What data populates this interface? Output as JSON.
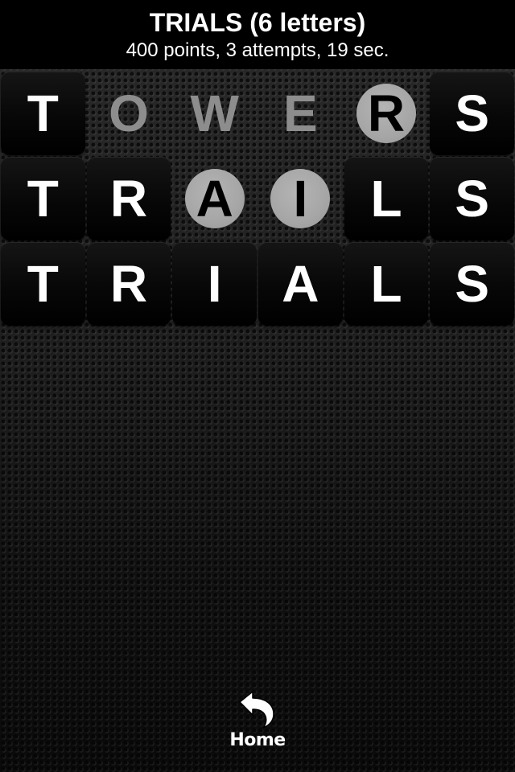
{
  "header": {
    "title": "TRIALS (6 letters)",
    "subtitle": "400 points, 3 attempts, 19 sec."
  },
  "board": {
    "rows": [
      {
        "word": "TOWERS",
        "tiles": [
          {
            "letter": "T",
            "state": "correct"
          },
          {
            "letter": "O",
            "state": "absent"
          },
          {
            "letter": "W",
            "state": "absent"
          },
          {
            "letter": "E",
            "state": "absent"
          },
          {
            "letter": "R",
            "state": "present"
          },
          {
            "letter": "S",
            "state": "correct"
          }
        ]
      },
      {
        "word": "TRAILS",
        "tiles": [
          {
            "letter": "T",
            "state": "correct"
          },
          {
            "letter": "R",
            "state": "correct"
          },
          {
            "letter": "A",
            "state": "present"
          },
          {
            "letter": "I",
            "state": "present"
          },
          {
            "letter": "L",
            "state": "correct"
          },
          {
            "letter": "S",
            "state": "correct"
          }
        ]
      },
      {
        "word": "TRIALS",
        "tiles": [
          {
            "letter": "T",
            "state": "correct"
          },
          {
            "letter": "R",
            "state": "correct"
          },
          {
            "letter": "I",
            "state": "correct"
          },
          {
            "letter": "A",
            "state": "correct"
          },
          {
            "letter": "L",
            "state": "correct"
          },
          {
            "letter": "S",
            "state": "correct"
          }
        ]
      }
    ]
  },
  "home_button": {
    "label": "Home",
    "icon": "back-arrow-icon"
  },
  "colors": {
    "header_bg": "#000000",
    "tile_bg": "#0a0a0a",
    "present_circle": "#a6a6a6",
    "absent_letter": "#8d8d8d",
    "letter": "#ffffff"
  }
}
